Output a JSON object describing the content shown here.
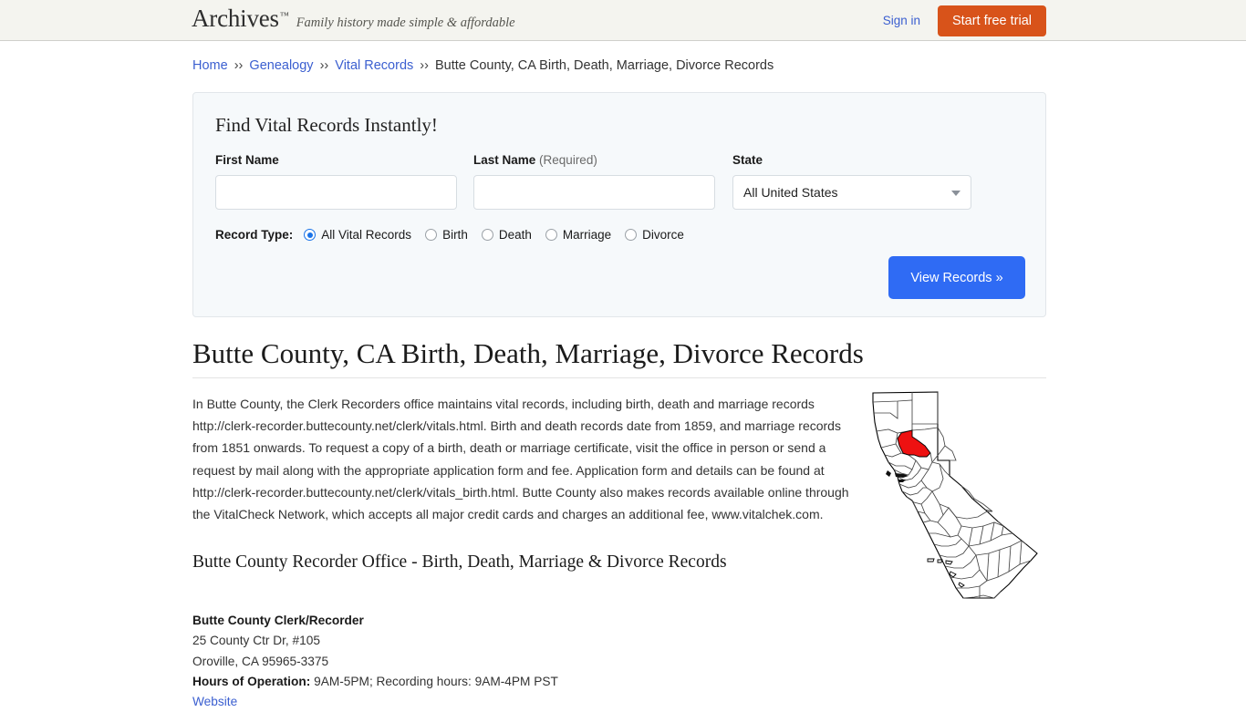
{
  "header": {
    "brand_name": "Archives",
    "brand_tm": "™",
    "tagline": "Family history made simple & affordable",
    "signin_label": "Sign in",
    "trial_label": "Start free trial",
    "accent_orange": "#d8531a",
    "link_blue": "#3b5fd0",
    "band_bg": "#f4f4ef"
  },
  "breadcrumb": {
    "separator": "››",
    "items": [
      {
        "label": "Home",
        "link": true
      },
      {
        "label": "Genealogy",
        "link": true
      },
      {
        "label": "Vital Records",
        "link": true
      },
      {
        "label": "Butte County, CA Birth, Death, Marriage, Divorce Records",
        "link": false
      }
    ]
  },
  "search_panel": {
    "title": "Find Vital Records Instantly!",
    "first_name": {
      "label": "First Name",
      "value": "",
      "placeholder": ""
    },
    "last_name": {
      "label": "Last Name",
      "required_note": "(Required)",
      "value": "",
      "placeholder": ""
    },
    "state": {
      "label": "State",
      "selected": "All United States"
    },
    "record_type": {
      "label": "Record Type:",
      "options": [
        {
          "label": "All Vital Records",
          "checked": true
        },
        {
          "label": "Birth",
          "checked": false
        },
        {
          "label": "Death",
          "checked": false
        },
        {
          "label": "Marriage",
          "checked": false
        },
        {
          "label": "Divorce",
          "checked": false
        }
      ]
    },
    "submit_label": "View Records »",
    "submit_color": "#2f6bf4",
    "panel_bg": "#f6f9fb"
  },
  "main": {
    "title": "Butte County, CA Birth, Death, Marriage, Divorce Records",
    "paragraph": "In Butte County, the Clerk Recorders office maintains vital records, including birth, death and marriage records http://clerk-recorder.buttecounty.net/clerk/vitals.html. Birth and death records date from 1859, and marriage records from 1851 onwards. To request a copy of a birth, death or marriage certificate, visit the office in person or send a request by mail along with the appropriate application form and fee. Application form and details can be found at http://clerk-recorder.buttecounty.net/clerk/vitals_birth.html. Butte County also makes records available online through the VitalCheck Network, which accepts all major credit cards and charges an additional fee, www.vitalchek.com.",
    "subheading": "Butte County Recorder Office - Birth, Death, Marriage & Divorce Records",
    "office": {
      "name": "Butte County Clerk/Recorder",
      "street": "25 County Ctr Dr, #105",
      "city_state_zip": "Oroville, CA 95965-3375",
      "hours_label": "Hours of Operation:",
      "hours_value": "9AM-5PM; Recording hours: 9AM-4PM PST",
      "website_label": "Website"
    },
    "map": {
      "alt": "Map of California with Butte County highlighted",
      "highlight_color": "#ee1111",
      "outline_color": "#000000",
      "county_line_color": "#555555"
    }
  }
}
